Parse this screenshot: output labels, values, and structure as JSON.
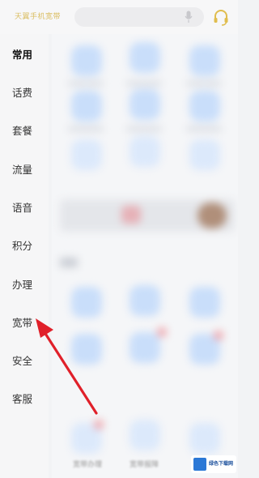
{
  "header": {
    "region_label": "天翼手机宽带",
    "icons": {
      "mic": "mic-icon",
      "service": "headset-icon"
    }
  },
  "sidebar": {
    "active_index": 0,
    "items": [
      {
        "label": "常用"
      },
      {
        "label": "话费"
      },
      {
        "label": "套餐"
      },
      {
        "label": "流量"
      },
      {
        "label": "语音"
      },
      {
        "label": "积分"
      },
      {
        "label": "办理"
      },
      {
        "label": "宽带"
      },
      {
        "label": "安全"
      },
      {
        "label": "客服"
      }
    ]
  },
  "content": {
    "bottom_labels": [
      "宽带办理",
      "宽带报障"
    ]
  },
  "annotation": {
    "arrow_color": "#e0202a",
    "points_to": "宽带"
  },
  "watermark": {
    "text": "绿色下载网"
  },
  "colors": {
    "accent_gold": "#d6b54a",
    "tile_blue": "#c9defa"
  }
}
